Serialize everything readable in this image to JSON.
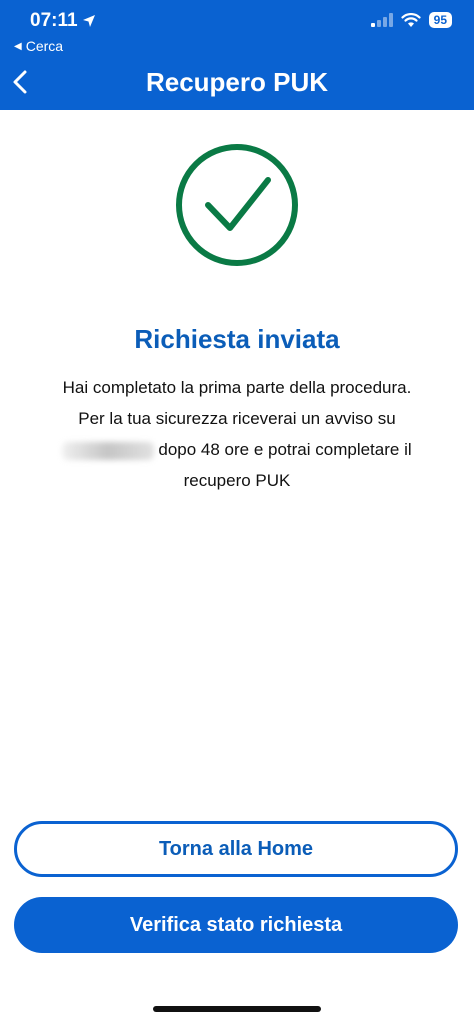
{
  "status_bar": {
    "time": "07:11",
    "back_app_label": "Cerca",
    "battery": "95"
  },
  "header": {
    "title": "Recupero PUK"
  },
  "content": {
    "title": "Richiesta inviata",
    "message_line1": "Hai completato la prima parte della procedura.",
    "message_line2": "Per la tua sicurezza riceverai un avviso su",
    "message_line3": "dopo 48 ore e potrai completare il",
    "message_line4": "recupero PUK"
  },
  "buttons": {
    "home_label": "Torna alla Home",
    "verify_label": "Verifica stato richiesta"
  },
  "colors": {
    "brand_blue": "#0a62d1",
    "title_blue": "#0b5db8",
    "success_green": "#0a7a45"
  },
  "icons": {
    "success": "check-circle-icon",
    "back": "chevron-left-icon",
    "location": "location-arrow-icon",
    "signal": "cellular-signal-icon",
    "wifi": "wifi-icon"
  }
}
